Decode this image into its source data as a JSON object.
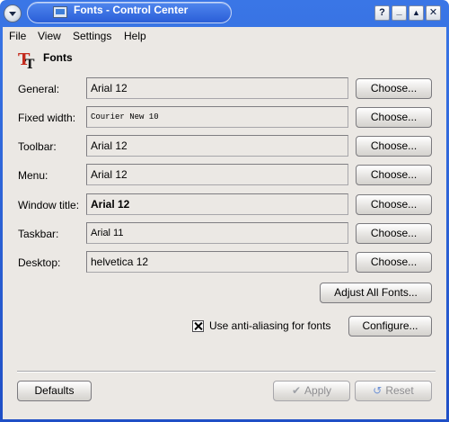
{
  "window": {
    "title": "Fonts - Control Center",
    "titlebar_buttons": {
      "help": "?",
      "minimize": "_",
      "maximize": "▲",
      "close": "✕"
    }
  },
  "menubar": {
    "file": "File",
    "view": "View",
    "settings": "Settings",
    "help": "Help"
  },
  "header": {
    "title": "Fonts",
    "icon": "fonts-icon"
  },
  "rows": [
    {
      "label": "General:",
      "value": "Arial 12",
      "button": "Choose..."
    },
    {
      "label": "Fixed width:",
      "value": "Courier New 10",
      "button": "Choose..."
    },
    {
      "label": "Toolbar:",
      "value": "Arial 12",
      "button": "Choose..."
    },
    {
      "label": "Menu:",
      "value": "Arial 12",
      "button": "Choose..."
    },
    {
      "label": "Window title:",
      "value": "Arial 12",
      "button": "Choose..."
    },
    {
      "label": "Taskbar:",
      "value": "Arial 11",
      "button": "Choose..."
    },
    {
      "label": "Desktop:",
      "value": "helvetica 12",
      "button": "Choose..."
    }
  ],
  "adjust_all_button": "Adjust All Fonts...",
  "antialias": {
    "checked": true,
    "label": "Use anti-aliasing for fonts",
    "configure_button": "Configure..."
  },
  "footer": {
    "defaults": "Defaults",
    "apply": "Apply",
    "reset": "Reset"
  },
  "colors": {
    "titlebar": "#2a5ed8",
    "client_background": "#ebe8e4",
    "disabled_text": "#8e8e91"
  }
}
